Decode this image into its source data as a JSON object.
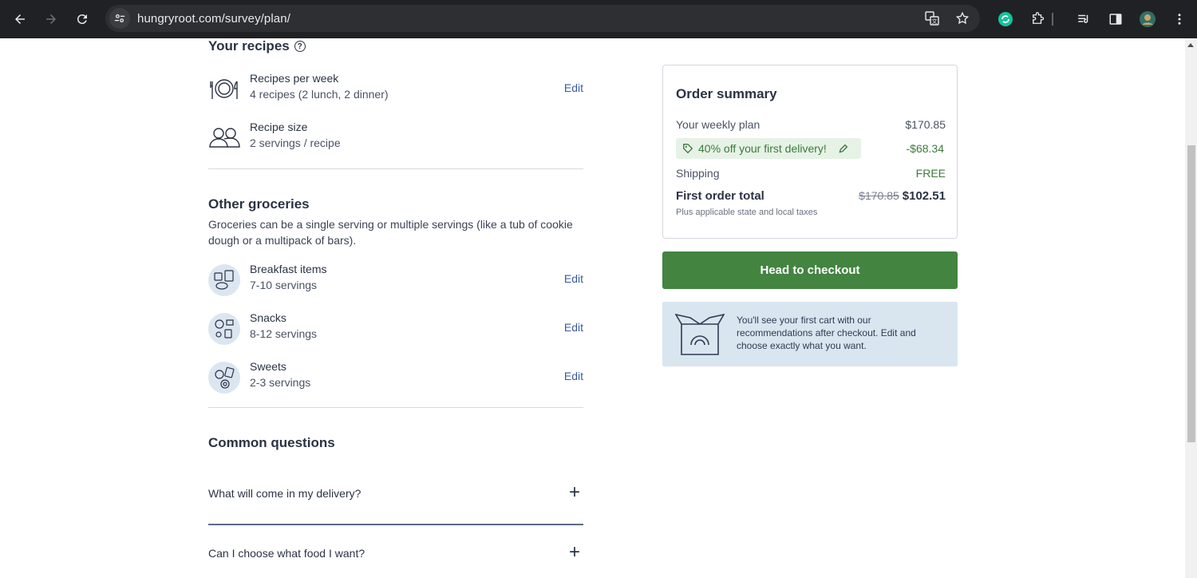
{
  "browser": {
    "url": "hungryroot.com/survey/plan/"
  },
  "recipes": {
    "heading": "Your recipes",
    "items": [
      {
        "title": "Recipes per week",
        "value": "4 recipes (2 lunch, 2 dinner)",
        "edit": "Edit"
      },
      {
        "title": "Recipe size",
        "value": "2 servings / recipe"
      }
    ]
  },
  "groceries": {
    "heading": "Other groceries",
    "description": "Groceries can be a single serving or multiple servings (like a tub of cookie dough or a multipack of bars).",
    "items": [
      {
        "title": "Breakfast items",
        "value": "7-10 servings",
        "edit": "Edit"
      },
      {
        "title": "Snacks",
        "value": "8-12 servings",
        "edit": "Edit"
      },
      {
        "title": "Sweets",
        "value": "2-3 servings",
        "edit": "Edit"
      }
    ]
  },
  "faq": {
    "heading": "Common questions",
    "items": [
      {
        "question": "What will come in my delivery?"
      },
      {
        "question": "Can I choose what food I want?"
      }
    ]
  },
  "summary": {
    "title": "Order summary",
    "weekly_plan_label": "Your weekly plan",
    "weekly_plan_value": "$170.85",
    "promo_label": "40% off your first delivery!",
    "promo_value": "-$68.34",
    "shipping_label": "Shipping",
    "shipping_value": "FREE",
    "total_label": "First order total",
    "total_original": "$170.85",
    "total_value": "$102.51",
    "taxes_note": "Plus applicable state and local taxes"
  },
  "checkout_label": "Head to checkout",
  "info_text": "You'll see your first cart with our recommendations after checkout. Edit and choose exactly what you want."
}
